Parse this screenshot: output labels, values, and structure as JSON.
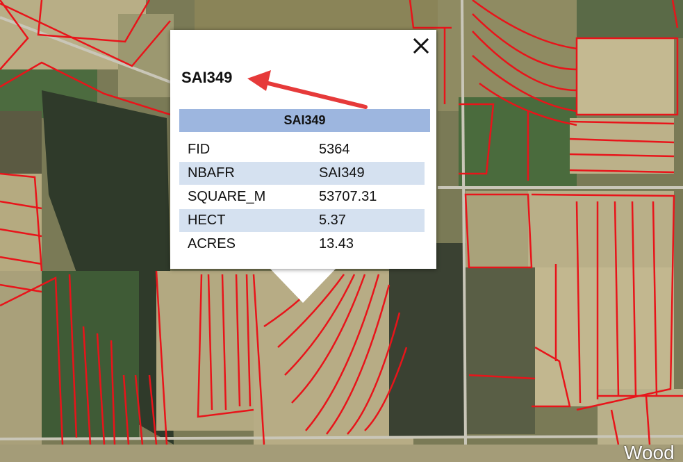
{
  "popup": {
    "title": "SAI349",
    "table_header": "SAI349",
    "rows": [
      {
        "key": "FID",
        "value": "5364"
      },
      {
        "key": "NBAFR",
        "value": "SAI349"
      },
      {
        "key": "SQUARE_M",
        "value": "53707.31"
      },
      {
        "key": "HECT",
        "value": "5.37"
      },
      {
        "key": "ACRES",
        "value": "13.43"
      }
    ],
    "close_icon": "close-icon"
  },
  "annotation": {
    "icon": "red-arrow-icon",
    "color": "#e63a3a"
  },
  "map": {
    "parcel_outline_color": "#e8141a",
    "imagery": "satellite-farmland"
  },
  "watermark": "Wood"
}
